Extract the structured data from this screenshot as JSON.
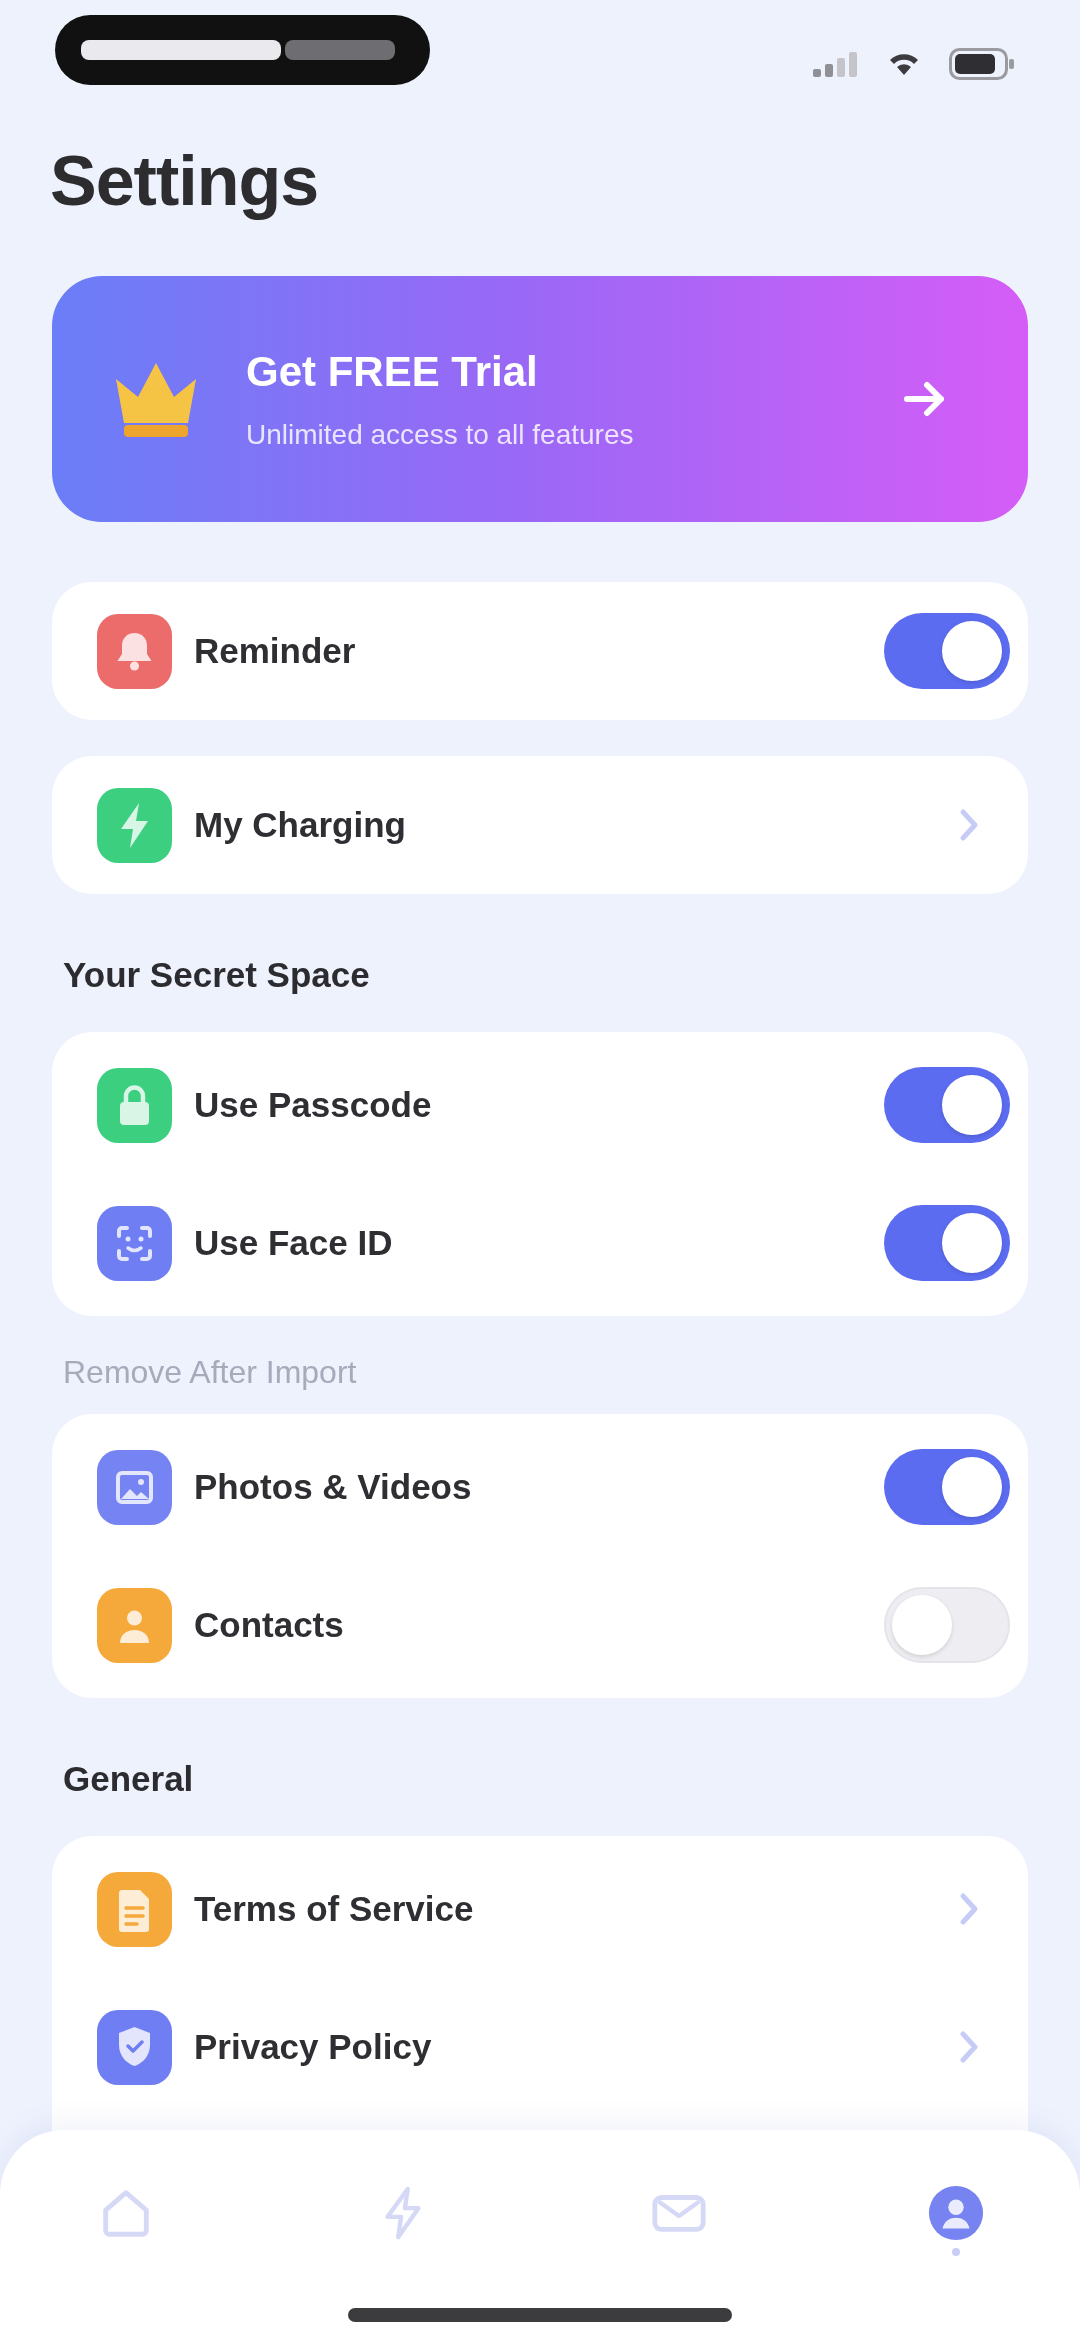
{
  "title": "Settings",
  "promo": {
    "title": "Get FREE Trial",
    "subtitle": "Unlimited access to all features"
  },
  "sections": [
    {
      "rows": [
        {
          "kind": "toggle",
          "label": "Reminder",
          "color": "#ec6b6b",
          "on": true
        }
      ]
    },
    {
      "rows": [
        {
          "kind": "link",
          "label": "My Charging",
          "color": "#3ccf80"
        }
      ]
    },
    {
      "header": {
        "text": "Your Secret Space",
        "muted": false
      },
      "rows": [
        {
          "kind": "toggle",
          "label": "Use Passcode",
          "color": "#3ccf80",
          "on": true
        },
        {
          "kind": "toggle",
          "label": "Use Face ID",
          "color": "#6f7ef2",
          "on": true
        }
      ]
    },
    {
      "header": {
        "text": "Remove After Import",
        "muted": true
      },
      "rows": [
        {
          "kind": "toggle",
          "label": "Photos & Videos",
          "color": "#7683f2",
          "on": true
        },
        {
          "kind": "toggle",
          "label": "Contacts",
          "color": "#f5a93a",
          "on": false
        }
      ]
    },
    {
      "header": {
        "text": "General",
        "muted": false
      },
      "rows": [
        {
          "kind": "link",
          "label": "Terms of Service",
          "color": "#f5a93a"
        },
        {
          "kind": "link",
          "label": "Privacy Policy",
          "color": "#6f7ef2"
        }
      ]
    }
  ],
  "tab_bar": {
    "items": [
      {
        "selected": false
      },
      {
        "selected": false
      },
      {
        "selected": false
      },
      {
        "selected": true
      }
    ]
  }
}
